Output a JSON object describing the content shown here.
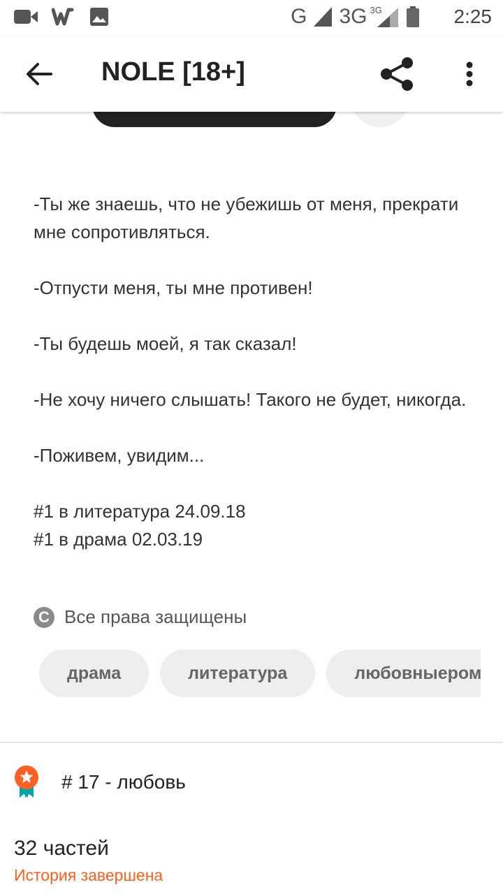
{
  "status_bar": {
    "network_g": "G",
    "network_3g": "3G",
    "network_3g_small": "3G",
    "time": "2:25"
  },
  "app_bar": {
    "title": "NOLE [18+]"
  },
  "description": {
    "lines": [
      "-Ты же знаешь, что не убежишь от меня, прекрати мне сопротивляться.",
      "-Отпусти меня, ты мне противен!",
      "-Ты будешь моей, я так сказал!",
      "-Не хочу ничего слышать! Такого не будет, никогда.",
      "-Поживем, увидим...",
      "#1 в литература 24.09.18",
      "#1 в драма 02.03.19"
    ]
  },
  "copyright": {
    "symbol": "C",
    "label": "Все права защищены"
  },
  "tags": [
    "драма",
    "литература",
    "любовныероман"
  ],
  "ranking": {
    "label": "# 17 - любовь"
  },
  "story": {
    "parts": "32 частей",
    "status": "История завершена"
  },
  "colors": {
    "accent": "#ff6122",
    "badge_orange": "#ff6122",
    "badge_teal": "#00a5a8",
    "tag_bg": "#efedef"
  }
}
